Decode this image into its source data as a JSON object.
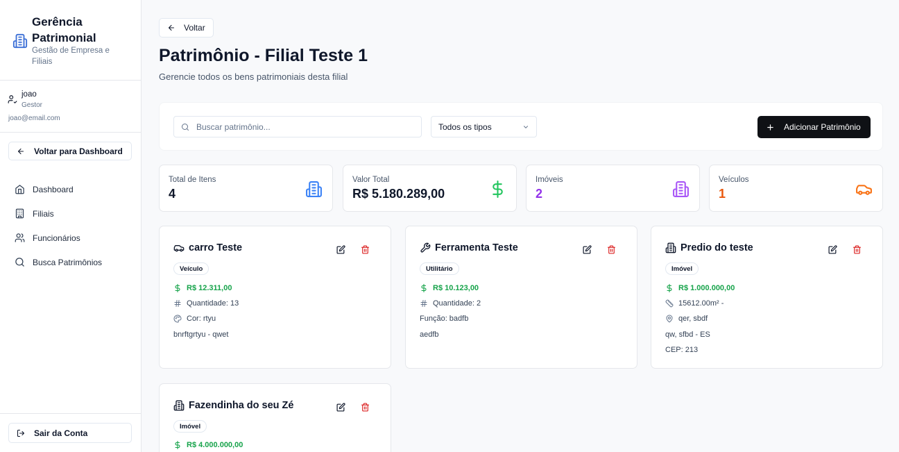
{
  "sidebar": {
    "brand_title": "Gerência Patrimonial",
    "brand_subtitle": "Gestão de Empresa e Filiais",
    "user_name": "joao",
    "user_role": "Gestor",
    "user_email": "joao@email.com",
    "back_dashboard": "Voltar para Dashboard",
    "nav": [
      {
        "label": "Dashboard",
        "icon": "home-icon"
      },
      {
        "label": "Filiais",
        "icon": "building-icon"
      },
      {
        "label": "Funcionários",
        "icon": "users-icon"
      },
      {
        "label": "Busca Patrimônios",
        "icon": "search-icon"
      }
    ],
    "logout": "Sair da Conta"
  },
  "header": {
    "back": "Voltar",
    "title": "Patrimônio - Filial Teste 1",
    "subtitle": "Gerencie todos os bens patrimoniais desta filial"
  },
  "toolbar": {
    "search_placeholder": "Buscar patrimônio...",
    "type_filter": "Todos os tipos",
    "add_button": "Adicionar Patrimônio"
  },
  "stats": [
    {
      "label": "Total de Itens",
      "value": "4",
      "color": "#0f172a",
      "icon": "building-icon",
      "icon_color": "#3b82f6"
    },
    {
      "label": "Valor Total",
      "value": "R$ 5.180.289,00",
      "color": "#0f172a",
      "icon": "dollar-icon",
      "icon_color": "#22c55e"
    },
    {
      "label": "Imóveis",
      "value": "2",
      "color": "#9333ea",
      "icon": "building-icon",
      "icon_color": "#a855f7"
    },
    {
      "label": "Veículos",
      "value": "1",
      "color": "#ea580c",
      "icon": "car-icon",
      "icon_color": "#f97316"
    }
  ],
  "cards": [
    {
      "title": "carro Teste",
      "icon": "car-icon",
      "type": "Veículo",
      "price": "R$ 12.311,00",
      "quantity": "Quantidade: 13",
      "detail": "Cor: rtyu",
      "description": "bnrftgrtyu - qwet"
    },
    {
      "title": "Ferramenta Teste",
      "icon": "wrench-icon",
      "type": "Utilitário",
      "price": "R$ 10.123,00",
      "quantity": "Quantidade: 2",
      "detail": "Função: badfb",
      "description": "aedfb"
    },
    {
      "title": "Predio do teste",
      "icon": "building-icon",
      "type": "Imóvel",
      "price": "R$ 1.000.000,00",
      "area": "15612.00m² -",
      "address": "qer, sbdf",
      "city": "qw, sfbd - ES",
      "cep": "CEP: 213"
    },
    {
      "title": "Fazendinha do seu Zé",
      "icon": "building-icon",
      "type": "Imóvel",
      "price": "R$ 4.000.000,00"
    }
  ]
}
